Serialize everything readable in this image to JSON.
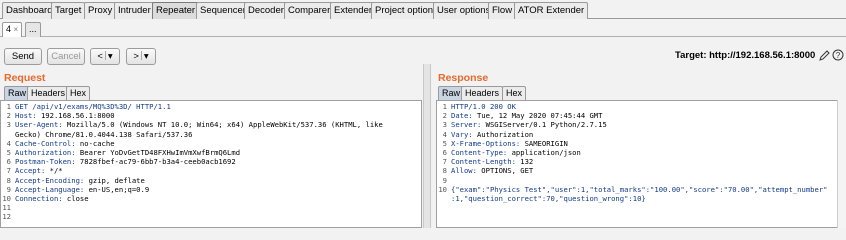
{
  "main_tabs": [
    "Dashboard",
    "Target",
    "Proxy",
    "Intruder",
    "Repeater",
    "Sequencer",
    "Decoder",
    "Comparer",
    "Extender",
    "Project options",
    "User options",
    "Flow",
    "ATOR Extender"
  ],
  "sub_tabs": [
    "4",
    "..."
  ],
  "toolbar": {
    "send": "Send",
    "cancel": "Cancel",
    "back": "<",
    "back_dropdown": "▾",
    "forward": ">",
    "forward_dropdown": "▾",
    "target": "Target: http://192.168.56.1:8000"
  },
  "request": {
    "title": "Request",
    "tabs": [
      "Raw",
      "Headers",
      "Hex"
    ],
    "lines": [
      {
        "n": "1",
        "k": "GET /api/v1/exams/MQ%3D%3D/ HTTP/1.1",
        "v": ""
      },
      {
        "n": "2",
        "k": "Host:",
        "v": " 192.168.56.1:8000"
      },
      {
        "n": "3",
        "k": "User-Agent:",
        "v": " Mozilla/5.0 (Windows NT 10.0; Win64; x64) AppleWebKit/537.36 (KHTML, like"
      },
      {
        "n": "",
        "k": "",
        "v": "Gecko) Chrome/81.0.4044.138 Safari/537.36"
      },
      {
        "n": "4",
        "k": "Cache-Control:",
        "v": " no-cache"
      },
      {
        "n": "5",
        "k": "Authorization:",
        "v": " Bearer YoDvGetTD48FXHwImVmXwfBrmQ6Lmd"
      },
      {
        "n": "6",
        "k": "Postman-Token:",
        "v": " 7828fbef-ac79-6bb7-b3a4-ceeb0acb1692"
      },
      {
        "n": "7",
        "k": "Accept:",
        "v": " */*"
      },
      {
        "n": "8",
        "k": "Accept-Encoding:",
        "v": " gzip, deflate"
      },
      {
        "n": "9",
        "k": "Accept-Language:",
        "v": " en-US,en;q=0.9"
      },
      {
        "n": "10",
        "k": "Connection:",
        "v": " close"
      },
      {
        "n": "11",
        "k": "",
        "v": ""
      },
      {
        "n": "12",
        "k": "",
        "v": ""
      }
    ]
  },
  "response": {
    "title": "Response",
    "tabs": [
      "Raw",
      "Headers",
      "Hex"
    ],
    "lines": [
      {
        "n": "1",
        "k": "HTTP/1.0 200 OK",
        "v": ""
      },
      {
        "n": "2",
        "k": "Date:",
        "v": " Tue, 12 May 2020 07:45:44 GMT"
      },
      {
        "n": "3",
        "k": "Server:",
        "v": " WSGIServer/0.1 Python/2.7.15"
      },
      {
        "n": "4",
        "k": "Vary:",
        "v": " Authorization"
      },
      {
        "n": "5",
        "k": "X-Frame-Options:",
        "v": " SAMEORIGIN"
      },
      {
        "n": "6",
        "k": "Content-Type:",
        "v": " application/json"
      },
      {
        "n": "7",
        "k": "Content-Length:",
        "v": " 132"
      },
      {
        "n": "8",
        "k": "Allow:",
        "v": " OPTIONS, GET"
      },
      {
        "n": "9",
        "k": "",
        "v": ""
      },
      {
        "n": "10",
        "k": "",
        "v": "{\"exam\":\"Physics Test\",\"user\":1,\"total_marks\":\"100.00\",\"score\":\"70.00\",\"attempt_number\""
      },
      {
        "n": "",
        "k": "",
        "v": ":1,\"question_correct\":70,\"question_wrong\":10}"
      }
    ]
  }
}
